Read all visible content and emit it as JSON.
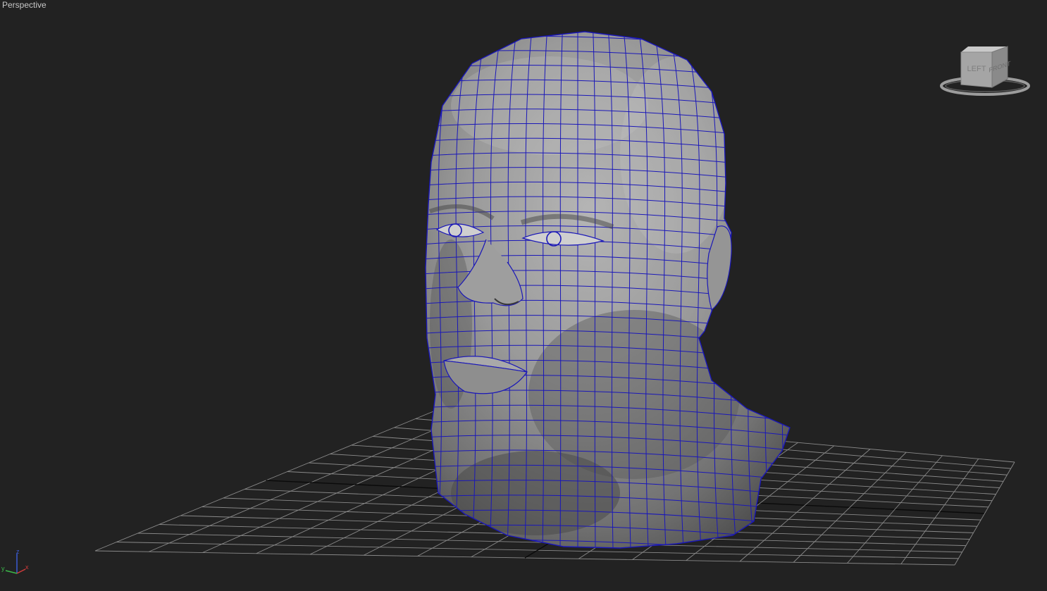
{
  "viewport": {
    "label": "Perspective",
    "background": "#222222",
    "grid_color": "#8a8a8a",
    "grid_axis_color": "#0a0a0a",
    "wire_color": "#1a17b8",
    "mesh_shade": "#8a8a8a"
  },
  "viewcube": {
    "faces": {
      "left": "LEFT",
      "front": "FRONT"
    },
    "icon": "viewcube-icon"
  },
  "axis_tripod": {
    "x": "x",
    "y": "y",
    "z": "z",
    "colors": {
      "x": "#d23b3b",
      "y": "#3bb84a",
      "z": "#3b5bd2"
    }
  }
}
